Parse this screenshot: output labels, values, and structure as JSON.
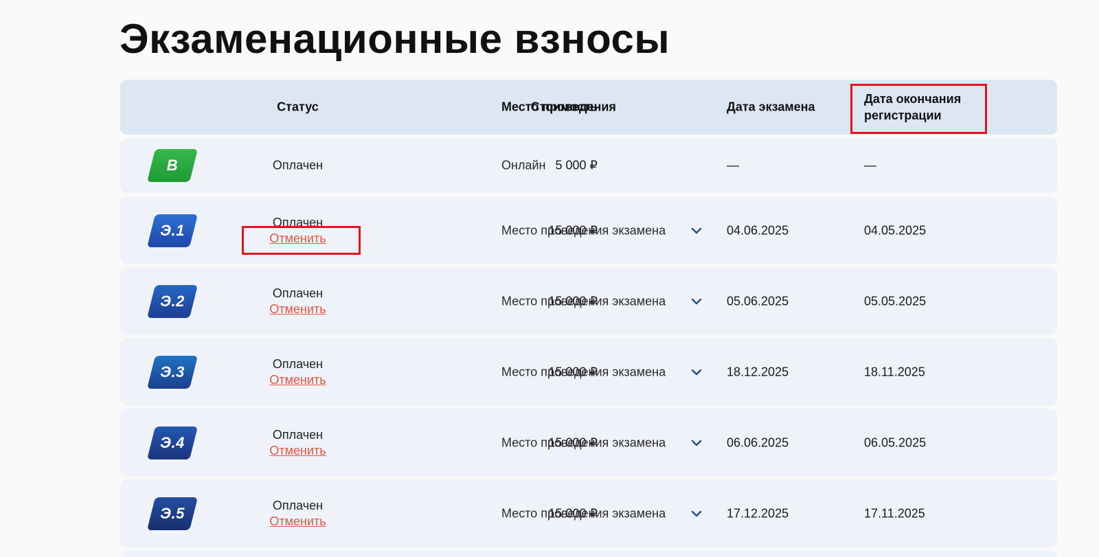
{
  "page": {
    "title": "Экзаменационные взносы"
  },
  "table": {
    "headers": {
      "status": "Статус",
      "cost": "Стоимость",
      "place": "Место проведения",
      "exam_date": "Дата экзамена",
      "reg_end_line1": "Дата окончания",
      "reg_end_line2": "регистрации"
    },
    "rows": [
      {
        "badge": "В",
        "badge_colors": [
          "#35b94a",
          "#1f9a35"
        ],
        "status": "Оплачен",
        "cancel": "",
        "cost": "5 000 ₽",
        "place": "Онлайн",
        "exam_date": "—",
        "reg_end": "—"
      },
      {
        "badge": "Э.1",
        "badge_colors": [
          "#2c6fd6",
          "#1e49a8"
        ],
        "status": "Оплачен",
        "cancel": "Отменить",
        "cost": "15 000 ₽",
        "place": "Место проведения экзамена",
        "exam_date": "04.06.2025",
        "reg_end": "04.05.2025"
      },
      {
        "badge": "Э.2",
        "badge_colors": [
          "#2566c6",
          "#1d3f94"
        ],
        "status": "Оплачен",
        "cancel": "Отменить",
        "cost": "15 000 ₽",
        "place": "Место проведения экзамена",
        "exam_date": "05.06.2025",
        "reg_end": "05.05.2025"
      },
      {
        "badge": "Э.3",
        "badge_colors": [
          "#1f72c4",
          "#1b3f8f"
        ],
        "status": "Оплачен",
        "cancel": "Отменить",
        "cost": "15 000 ₽",
        "place": "Место проведения экзамена",
        "exam_date": "18.12.2025",
        "reg_end": "18.11.2025"
      },
      {
        "badge": "Э.4",
        "badge_colors": [
          "#2458b3",
          "#1b337a"
        ],
        "status": "Оплачен",
        "cancel": "Отменить",
        "cost": "15 000 ₽",
        "place": "Место проведения экзамена",
        "exam_date": "06.06.2025",
        "reg_end": "06.05.2025"
      },
      {
        "badge": "Э.5",
        "badge_colors": [
          "#224fa3",
          "#1a2f6e"
        ],
        "status": "Оплачен",
        "cancel": "Отменить",
        "cost": "15 000 ₽",
        "place": "Место проведения экзамена",
        "exam_date": "17.12.2025",
        "reg_end": "17.11.2025"
      }
    ]
  },
  "colors": {
    "highlight": "#e3131b",
    "cancel_link": "#e25540",
    "header_bg": "#dde6f3",
    "row_bg": "#eff2f9"
  },
  "icons": {
    "expand": "chevron-down-icon"
  }
}
